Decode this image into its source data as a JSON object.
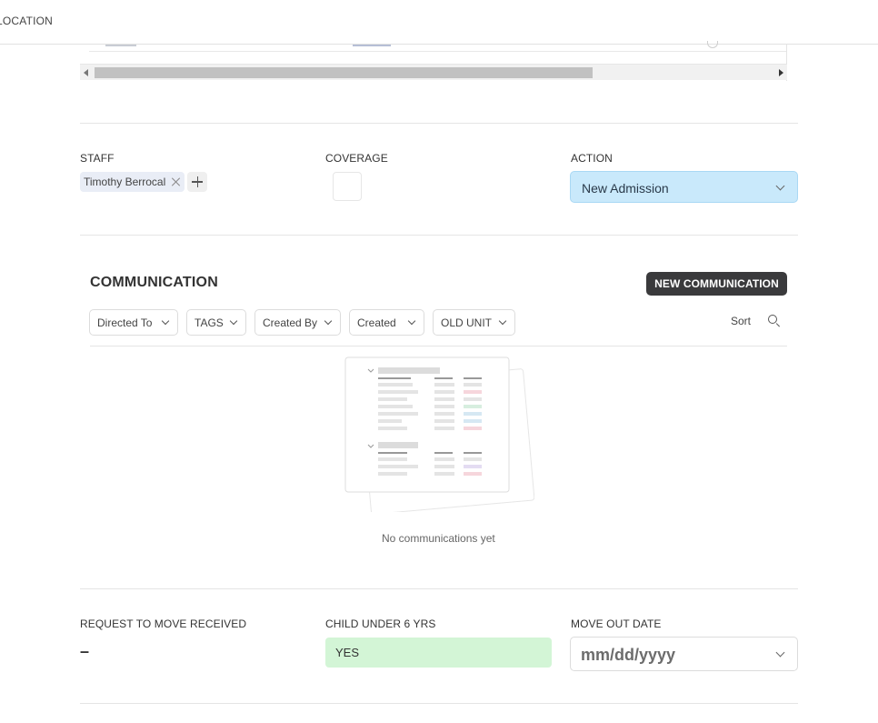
{
  "header": {
    "breadcrumb_text": "LOCATION"
  },
  "fields_row1": {
    "staff": {
      "label": "STAFF",
      "tags": [
        "Timothy Berrocal"
      ]
    },
    "coverage": {
      "label": "COVERAGE",
      "checked": false
    },
    "action": {
      "label": "ACTION",
      "value": "New Admission",
      "accent": "#c9e9fb"
    }
  },
  "communication": {
    "title": "COMMUNICATION",
    "new_button_label": "NEW COMMUNICATION",
    "filters": [
      "Directed To",
      "TAGS",
      "Created By",
      "Created",
      "OLD UNIT"
    ],
    "sort_label": "Sort",
    "empty_text": "No communications yet"
  },
  "fields_row2": {
    "request_to_move": {
      "label": "REQUEST TO MOVE RECEIVED",
      "value": "–"
    },
    "child_under_6": {
      "label": "CHILD UNDER 6 YRS",
      "value": "YES",
      "accent": "#d3f5d6"
    },
    "move_out_date": {
      "label": "MOVE OUT DATE",
      "placeholder": "mm/dd/yyyy"
    }
  },
  "icons": [
    "remove-tag-icon",
    "plus-icon",
    "chevron-down-icon",
    "search-icon",
    "scroll-left-arrow-icon",
    "scroll-right-arrow-icon",
    "empty-list-illustration"
  ]
}
